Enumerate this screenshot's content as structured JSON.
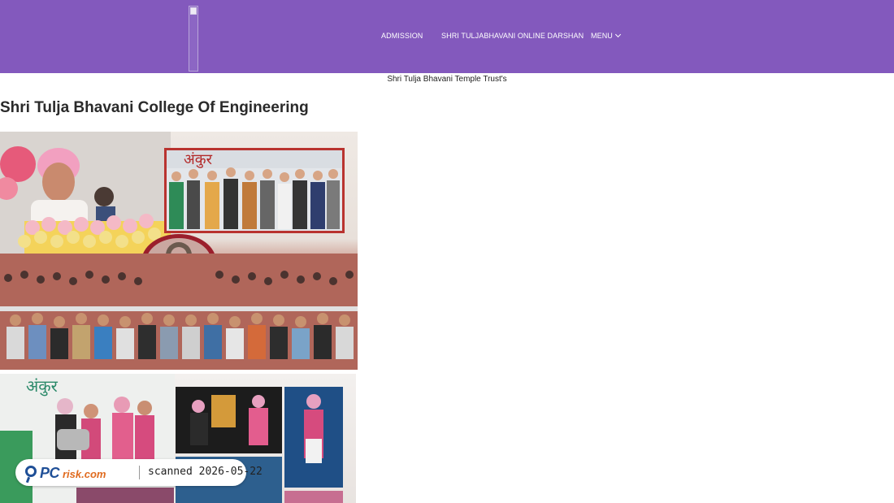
{
  "header": {
    "logo_alt": "",
    "nav": [
      {
        "label": "ADMISSION"
      },
      {
        "label": "SHRI TULJABHAVANI ONLINE DARSHAN"
      },
      {
        "label": "MENU"
      }
    ],
    "menu_icon": "chevron-down-icon"
  },
  "main": {
    "trust_name": "Shri Tulja Bhavani Temple Trust's",
    "page_title": "Shri Tulja Bhavani College Of Engineering",
    "photos": [
      {
        "banner_text": "अंकुर"
      },
      {
        "banner_text": "अंकुर"
      }
    ]
  },
  "watermark": {
    "brand_pc": "PC",
    "brand_risk": "risk.com",
    "scanned_text": "scanned 2026-05-22"
  },
  "colors": {
    "header_bg": "#8359bd",
    "nav_text": "#ffffff",
    "title_text": "#2a2a2a"
  }
}
